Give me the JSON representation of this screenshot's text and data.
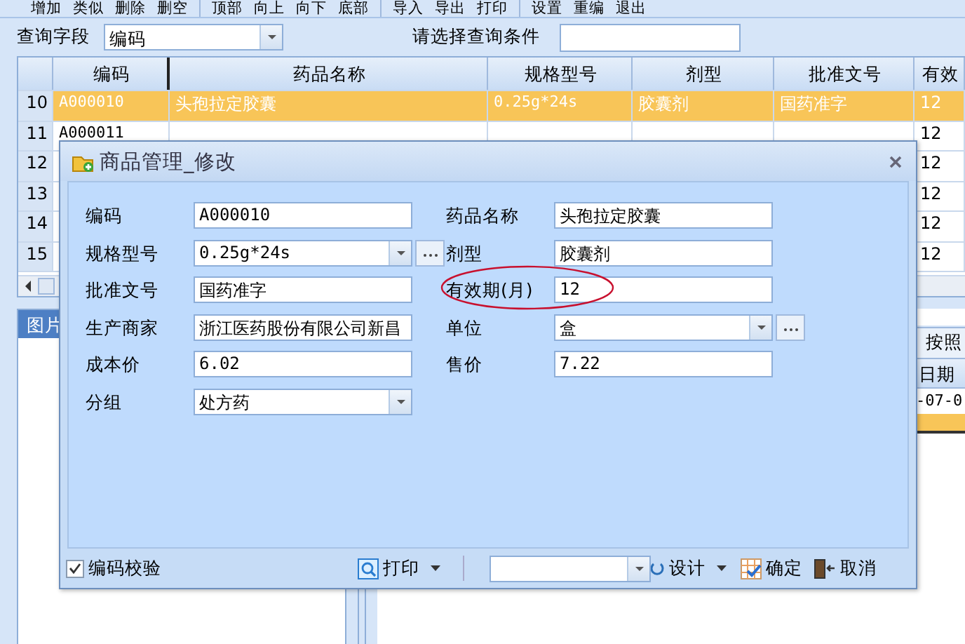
{
  "toolbar": {
    "groups": [
      [
        "增加",
        "类似",
        "删除",
        "删空"
      ],
      [
        "顶部",
        "向上",
        "向下",
        "底部"
      ],
      [
        "导入",
        "导出",
        "打印"
      ],
      [
        "设置",
        "重编",
        "退出"
      ]
    ]
  },
  "query": {
    "field_label": "查询字段",
    "field_value": "编码",
    "condition_label": "请选择查询条件"
  },
  "grid": {
    "columns": [
      "编码",
      "药品名称",
      "规格型号",
      "剂型",
      "批准文号",
      "有效"
    ],
    "rows": [
      {
        "number": "10",
        "selected": true,
        "cells": [
          "A000010",
          "头孢拉定胶囊",
          "0.25g*24s",
          "胶囊剂",
          "国药准字",
          "12"
        ]
      },
      {
        "number": "11",
        "selected": false,
        "cells": [
          "A000011",
          null,
          null,
          null,
          null,
          "12"
        ]
      },
      {
        "number": "12",
        "selected": false,
        "cells": [
          null,
          null,
          null,
          null,
          null,
          "12"
        ]
      },
      {
        "number": "13",
        "selected": false,
        "cells": [
          null,
          null,
          null,
          null,
          null,
          "12"
        ]
      },
      {
        "number": "14",
        "selected": false,
        "cells": [
          null,
          null,
          null,
          null,
          null,
          "12"
        ]
      },
      {
        "number": "15",
        "selected": false,
        "cells": [
          null,
          null,
          null,
          null,
          null,
          "12"
        ]
      }
    ]
  },
  "lower_left": {
    "tab": "图片"
  },
  "lower_right": {
    "button": "按照",
    "column_1": "日期",
    "rows": [
      {
        "cell": "-07-0",
        "selected": false
      },
      {
        "cell": null,
        "selected": true
      }
    ]
  },
  "dialog": {
    "title": "商品管理_修改",
    "fields": [
      {
        "label": "编码",
        "value": "A000010",
        "kind": "text"
      },
      {
        "label": "药品名称",
        "value": "头孢拉定胶囊",
        "kind": "text"
      },
      {
        "label": "规格型号",
        "value": "0.25g*24s",
        "kind": "combo_more"
      },
      {
        "label": "剂型",
        "value": "胶囊剂",
        "kind": "text"
      },
      {
        "label": "批准文号",
        "value": "国药准字",
        "kind": "text"
      },
      {
        "label": "有效期(月)",
        "value": "12",
        "kind": "text"
      },
      {
        "label": "生产商家",
        "value": "浙江医药股份有限公司新昌",
        "kind": "text"
      },
      {
        "label": "单位",
        "value": "盒",
        "kind": "combo_more"
      },
      {
        "label": "成本价",
        "value": "6.02",
        "kind": "text"
      },
      {
        "label": "售价",
        "value": "7.22",
        "kind": "text"
      },
      {
        "label": "分组",
        "value": "处方药",
        "kind": "combo"
      }
    ],
    "footer": {
      "checkbox": {
        "label": "编码校验",
        "checked": true
      },
      "print": "打印",
      "design": "设计",
      "ok": "确定",
      "cancel": "取消"
    }
  }
}
